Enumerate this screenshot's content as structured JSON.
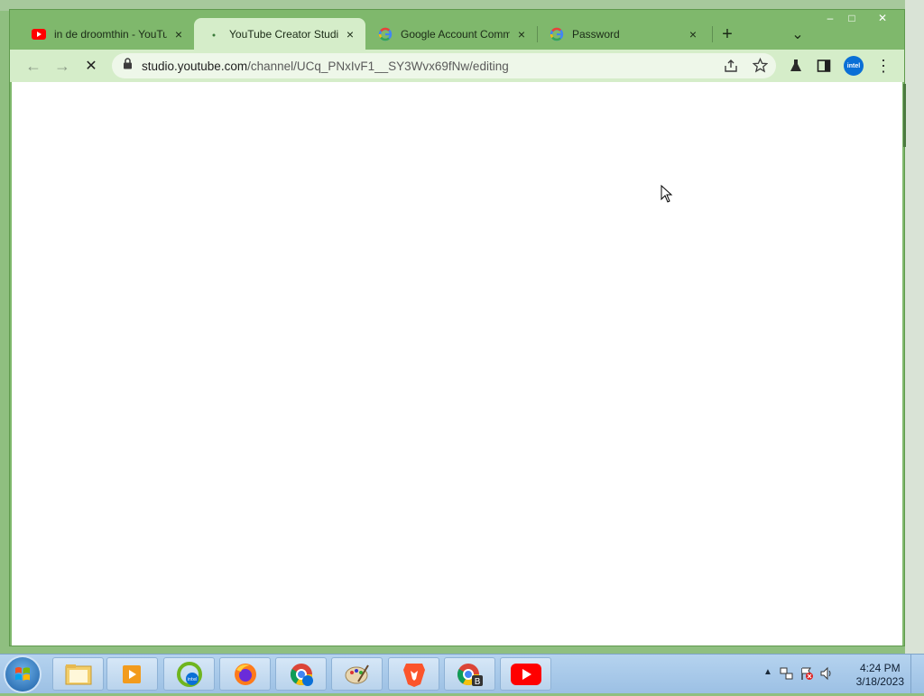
{
  "window": {
    "controls": {
      "minimize": "–",
      "restore": "□",
      "close": "✕"
    }
  },
  "tabs": [
    {
      "label": "in de droomthin - YouTube",
      "icon": "youtube-icon",
      "active": false
    },
    {
      "label": "YouTube Creator Studio",
      "icon": "loading-dot-icon",
      "active": true
    },
    {
      "label": "Google Account Comm",
      "icon": "google-icon",
      "active": false
    },
    {
      "label": "Password",
      "icon": "google-icon",
      "active": false
    }
  ],
  "tabstrip": {
    "new_tab": "+",
    "tab_search": "⌄"
  },
  "toolbar": {
    "back": "←",
    "forward": "→",
    "stop": "✕",
    "url_host": "studio.youtube.com",
    "url_path": "/channel/UCq_PNxIvF1__SY3Wvx69fNw/editing",
    "profile": "intel"
  },
  "taskbar": {
    "apps": [
      {
        "name": "file-explorer"
      },
      {
        "name": "media-player"
      },
      {
        "name": "intel-driver-assistant"
      },
      {
        "name": "firefox"
      },
      {
        "name": "chrome-intel"
      },
      {
        "name": "paint"
      },
      {
        "name": "brave"
      },
      {
        "name": "chrome-b"
      },
      {
        "name": "youtube"
      }
    ],
    "time": "4:24 PM",
    "date": "3/18/2023"
  },
  "colors": {
    "frame": "#7fb86c",
    "toolbar": "#d5edc9",
    "youtube_red": "#ff0000"
  }
}
